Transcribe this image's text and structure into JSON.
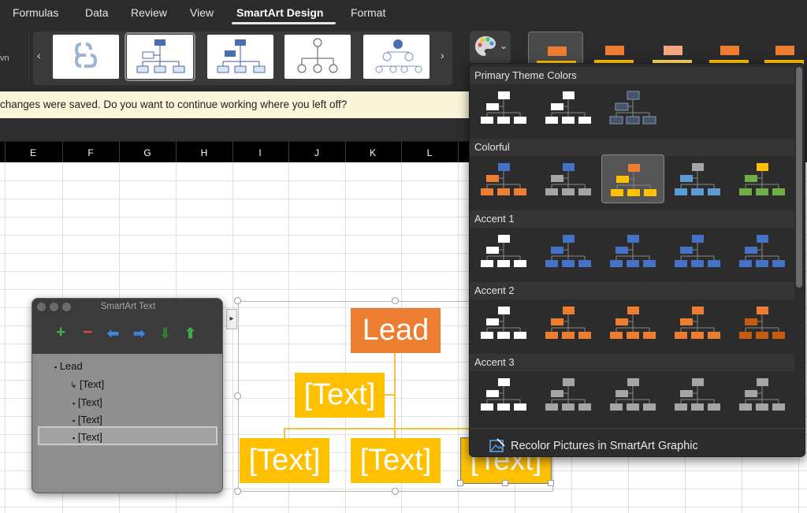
{
  "ribbon": {
    "tabs": [
      {
        "label": "Formulas"
      },
      {
        "label": "Data"
      },
      {
        "label": "Review"
      },
      {
        "label": "View"
      },
      {
        "label": "SmartArt Design",
        "active": true
      },
      {
        "label": "Format"
      }
    ],
    "truncated_label": "vn",
    "layout_gallery_prev": "‹",
    "layout_gallery_next": "›",
    "change_colors_chevron": "⌄"
  },
  "notification": {
    "text": "changes were saved. Do you want to continue working where you left off?"
  },
  "sheet": {
    "columns": [
      "E",
      "F",
      "G",
      "H",
      "I",
      "J",
      "K",
      "L"
    ]
  },
  "smartart": {
    "lead": "Lead",
    "nodes": [
      "[Text]",
      "[Text]",
      "[Text]",
      "[Text]"
    ],
    "pane_toggle_glyph": "▸",
    "colors": {
      "lead": "#ed7d31",
      "child": "#ffc000"
    }
  },
  "text_pane": {
    "title": "SmartArt Text",
    "tools": [
      {
        "icon": "add-icon",
        "glyph": "+",
        "color": "#3fae49"
      },
      {
        "icon": "remove-icon",
        "glyph": "−",
        "color": "#e2454a"
      },
      {
        "icon": "promote-icon",
        "glyph": "⬅",
        "color": "#3d86d8"
      },
      {
        "icon": "demote-icon",
        "glyph": "➡",
        "color": "#3d86d8"
      },
      {
        "icon": "move-down-icon",
        "glyph": "⬇",
        "color": "#2f7d39"
      },
      {
        "icon": "move-up-icon",
        "glyph": "⬆",
        "color": "#3fae49"
      }
    ],
    "items": [
      {
        "text": "Lead",
        "bullet": "▪",
        "level": 0
      },
      {
        "text": "[Text]",
        "bullet": "↳",
        "level": 1
      },
      {
        "text": "[Text]",
        "bullet": "▪",
        "level": 1
      },
      {
        "text": "[Text]",
        "bullet": "▪",
        "level": 1
      },
      {
        "text": "[Text]",
        "bullet": "▪",
        "level": 1,
        "selected": true
      }
    ]
  },
  "color_menu": {
    "sections": [
      {
        "label": "Primary Theme Colors",
        "options": [
          {
            "top": "#ffffff",
            "mid": "#ffffff",
            "bottom": "#ffffff"
          },
          {
            "top": "#ffffff",
            "mid": "#ffffff",
            "bottom": "#ffffff"
          },
          {
            "top": "#44546a",
            "mid": "#44546a",
            "bottom": "#44546a",
            "outline": "#8496b0"
          }
        ]
      },
      {
        "label": "Colorful",
        "options": [
          {
            "top": "#4472c4",
            "mid": "#ed7d31",
            "bottom": "#ed7d31"
          },
          {
            "top": "#4472c4",
            "mid": "#a5a5a5",
            "bottom": "#a5a5a5"
          },
          {
            "top": "#ed7d31",
            "mid": "#ffc000",
            "bottom": "#ffc000",
            "selected": true
          },
          {
            "top": "#a5a5a5",
            "mid": "#5b9bd5",
            "bottom": "#5b9bd5"
          },
          {
            "top": "#ffc000",
            "mid": "#70ad47",
            "bottom": "#70ad47"
          }
        ]
      },
      {
        "label": "Accent 1",
        "options": [
          {
            "top": "#ffffff",
            "mid": "#ffffff",
            "bottom": "#ffffff"
          },
          {
            "top": "#4472c4",
            "mid": "#4472c4",
            "bottom": "#4472c4"
          },
          {
            "top": "#4472c4",
            "mid": "#4472c4",
            "bottom": "#4472c4"
          },
          {
            "top": "#4472c4",
            "mid": "#4472c4",
            "bottom": "#4472c4"
          },
          {
            "top": "#4472c4",
            "mid": "#4472c4",
            "bottom": "#4472c4"
          }
        ]
      },
      {
        "label": "Accent 2",
        "options": [
          {
            "top": "#ffffff",
            "mid": "#ffffff",
            "bottom": "#ffffff"
          },
          {
            "top": "#ed7d31",
            "mid": "#ed7d31",
            "bottom": "#ed7d31"
          },
          {
            "top": "#ed7d31",
            "mid": "#ed7d31",
            "bottom": "#ed7d31"
          },
          {
            "top": "#ed7d31",
            "mid": "#ed7d31",
            "bottom": "#ed7d31"
          },
          {
            "top": "#ed7d31",
            "mid": "#c55a11",
            "bottom": "#c55a11"
          }
        ]
      },
      {
        "label": "Accent 3",
        "options": [
          {
            "top": "#ffffff",
            "mid": "#ffffff",
            "bottom": "#ffffff"
          },
          {
            "top": "#a5a5a5",
            "mid": "#a5a5a5",
            "bottom": "#a5a5a5"
          },
          {
            "top": "#a5a5a5",
            "mid": "#a5a5a5",
            "bottom": "#a5a5a5"
          },
          {
            "top": "#a5a5a5",
            "mid": "#a5a5a5",
            "bottom": "#a5a5a5"
          },
          {
            "top": "#a5a5a5",
            "mid": "#a5a5a5",
            "bottom": "#a5a5a5"
          }
        ]
      }
    ],
    "recolor_label": "Recolor Pictures in SmartArt Graphic"
  }
}
